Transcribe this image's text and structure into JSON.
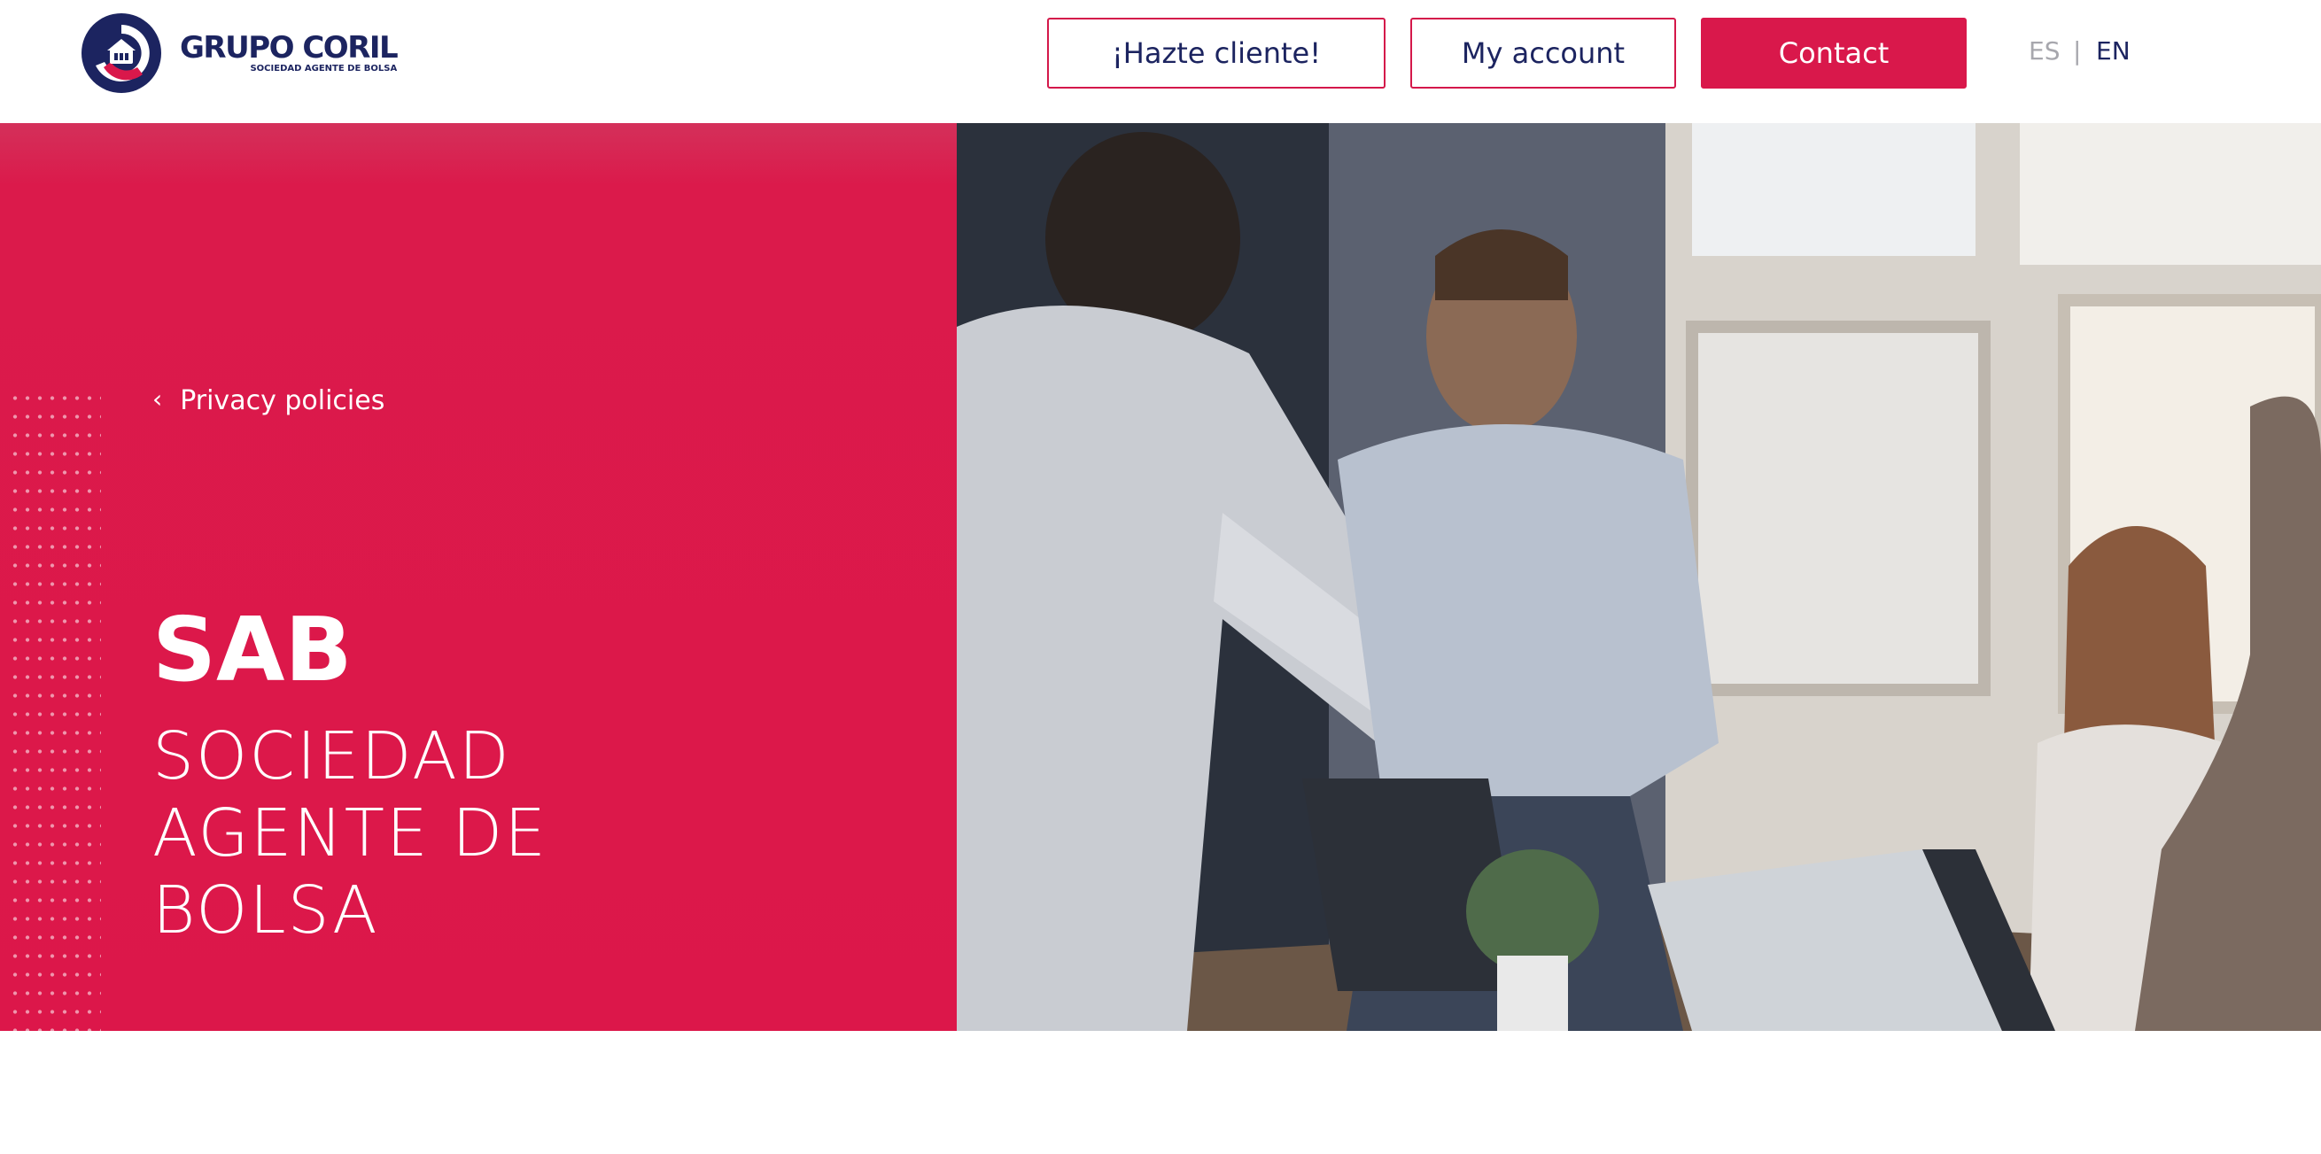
{
  "header": {
    "logo": {
      "name": "GRUPO CORIL",
      "tagline": "SOCIEDAD AGENTE DE BOLSA",
      "icon": "coril-emblem-icon"
    },
    "buttons": {
      "hazte_cliente": "¡Hazte cliente!",
      "my_account": "My account",
      "contact": "Contact"
    },
    "languages": [
      "ES",
      "EN"
    ],
    "language_separator": "|",
    "active_language": "EN"
  },
  "hero": {
    "breadcrumb": {
      "icon": "chevron-left-icon",
      "label": "Privacy policies"
    },
    "title": "SAB",
    "subtitle_lines": [
      "SOCIEDAD",
      "AGENTE DE",
      "BOLSA"
    ],
    "image": "business-handshake-photo"
  },
  "colors": {
    "brand_red": "#dc174a",
    "brand_navy": "#1c2460",
    "muted_gray": "#a7a7ad",
    "white": "#ffffff"
  }
}
